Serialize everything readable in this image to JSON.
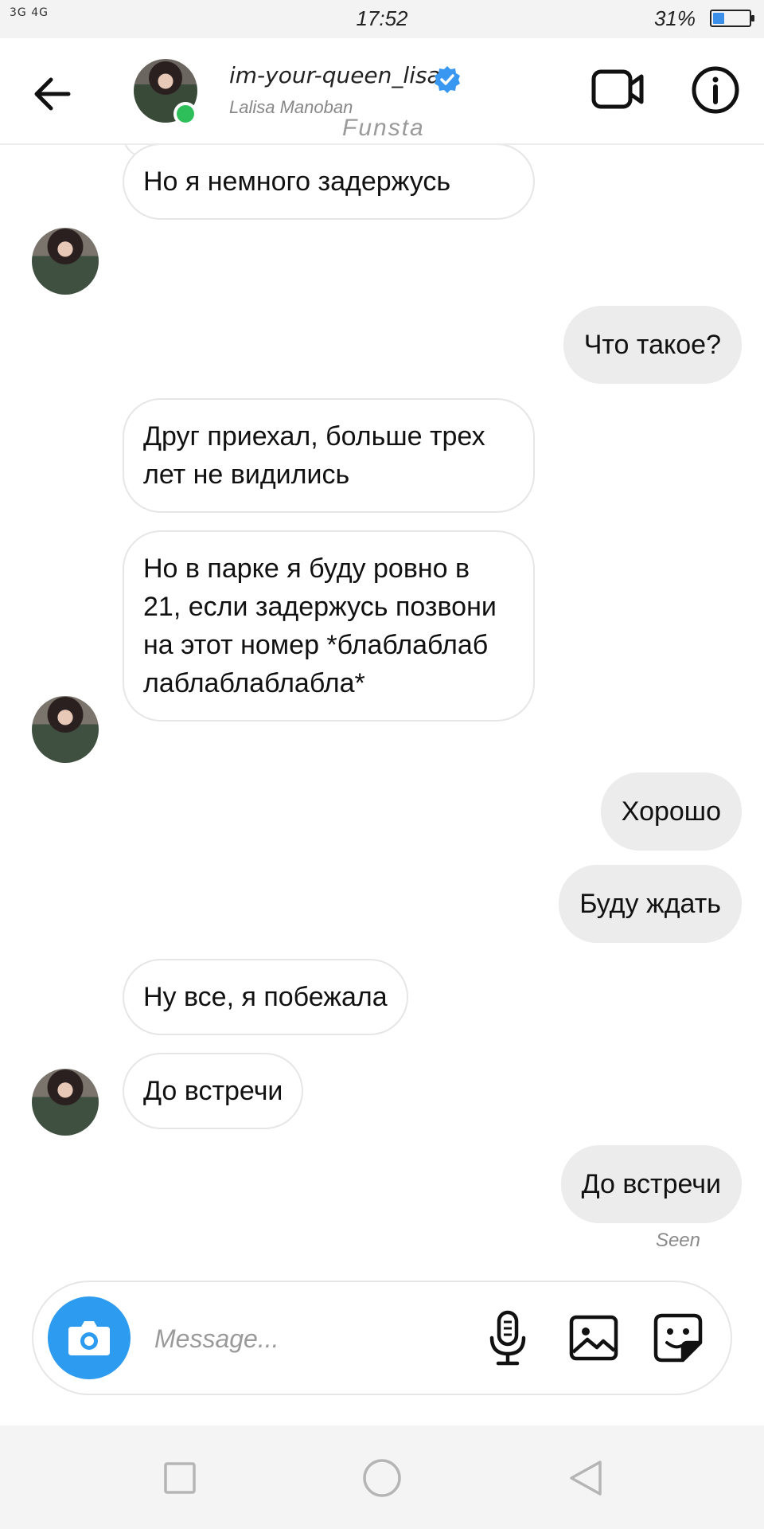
{
  "status": {
    "signal": "3G 4G",
    "time": "17:52",
    "battery": "31%",
    "battery_level": 0.31
  },
  "header": {
    "username": "im-your-queen_lisa",
    "subtitle": "Lalisa Manoban",
    "watermark": "Funsta"
  },
  "messages": [
    {
      "side": "in",
      "text": "Но я немного задержусь"
    },
    {
      "side": "out",
      "text": "Что такое?"
    },
    {
      "side": "in",
      "text": "Друг приехал, больше трех лет не видились"
    },
    {
      "side": "in",
      "text": "Но в парке я буду ровно в 21, если задержусь позвони на этот номер *блаблаблаб лаблаблаблабла*"
    },
    {
      "side": "out",
      "text": "Хорошо"
    },
    {
      "side": "out",
      "text": "Буду ждать"
    },
    {
      "side": "in",
      "text": "Ну все, я побежала"
    },
    {
      "side": "in",
      "text": "До встречи"
    },
    {
      "side": "out",
      "text": "До встречи"
    }
  ],
  "seen_label": "Seen",
  "composer": {
    "placeholder": "Message..."
  },
  "icons": {
    "back": "arrow-left-icon",
    "verified": "verified-badge-icon",
    "video": "video-camera-icon",
    "info": "info-icon",
    "camera": "camera-icon",
    "mic": "microphone-icon",
    "gallery": "image-icon",
    "sticker": "sticker-icon",
    "nav_recent": "square-icon",
    "nav_home": "circle-icon",
    "nav_back": "triangle-back-icon"
  },
  "colors": {
    "accent": "#2d9bf0",
    "online": "#2fbf5a",
    "outgoing_bubble": "#ececec",
    "battery": "#3b8fe8"
  }
}
